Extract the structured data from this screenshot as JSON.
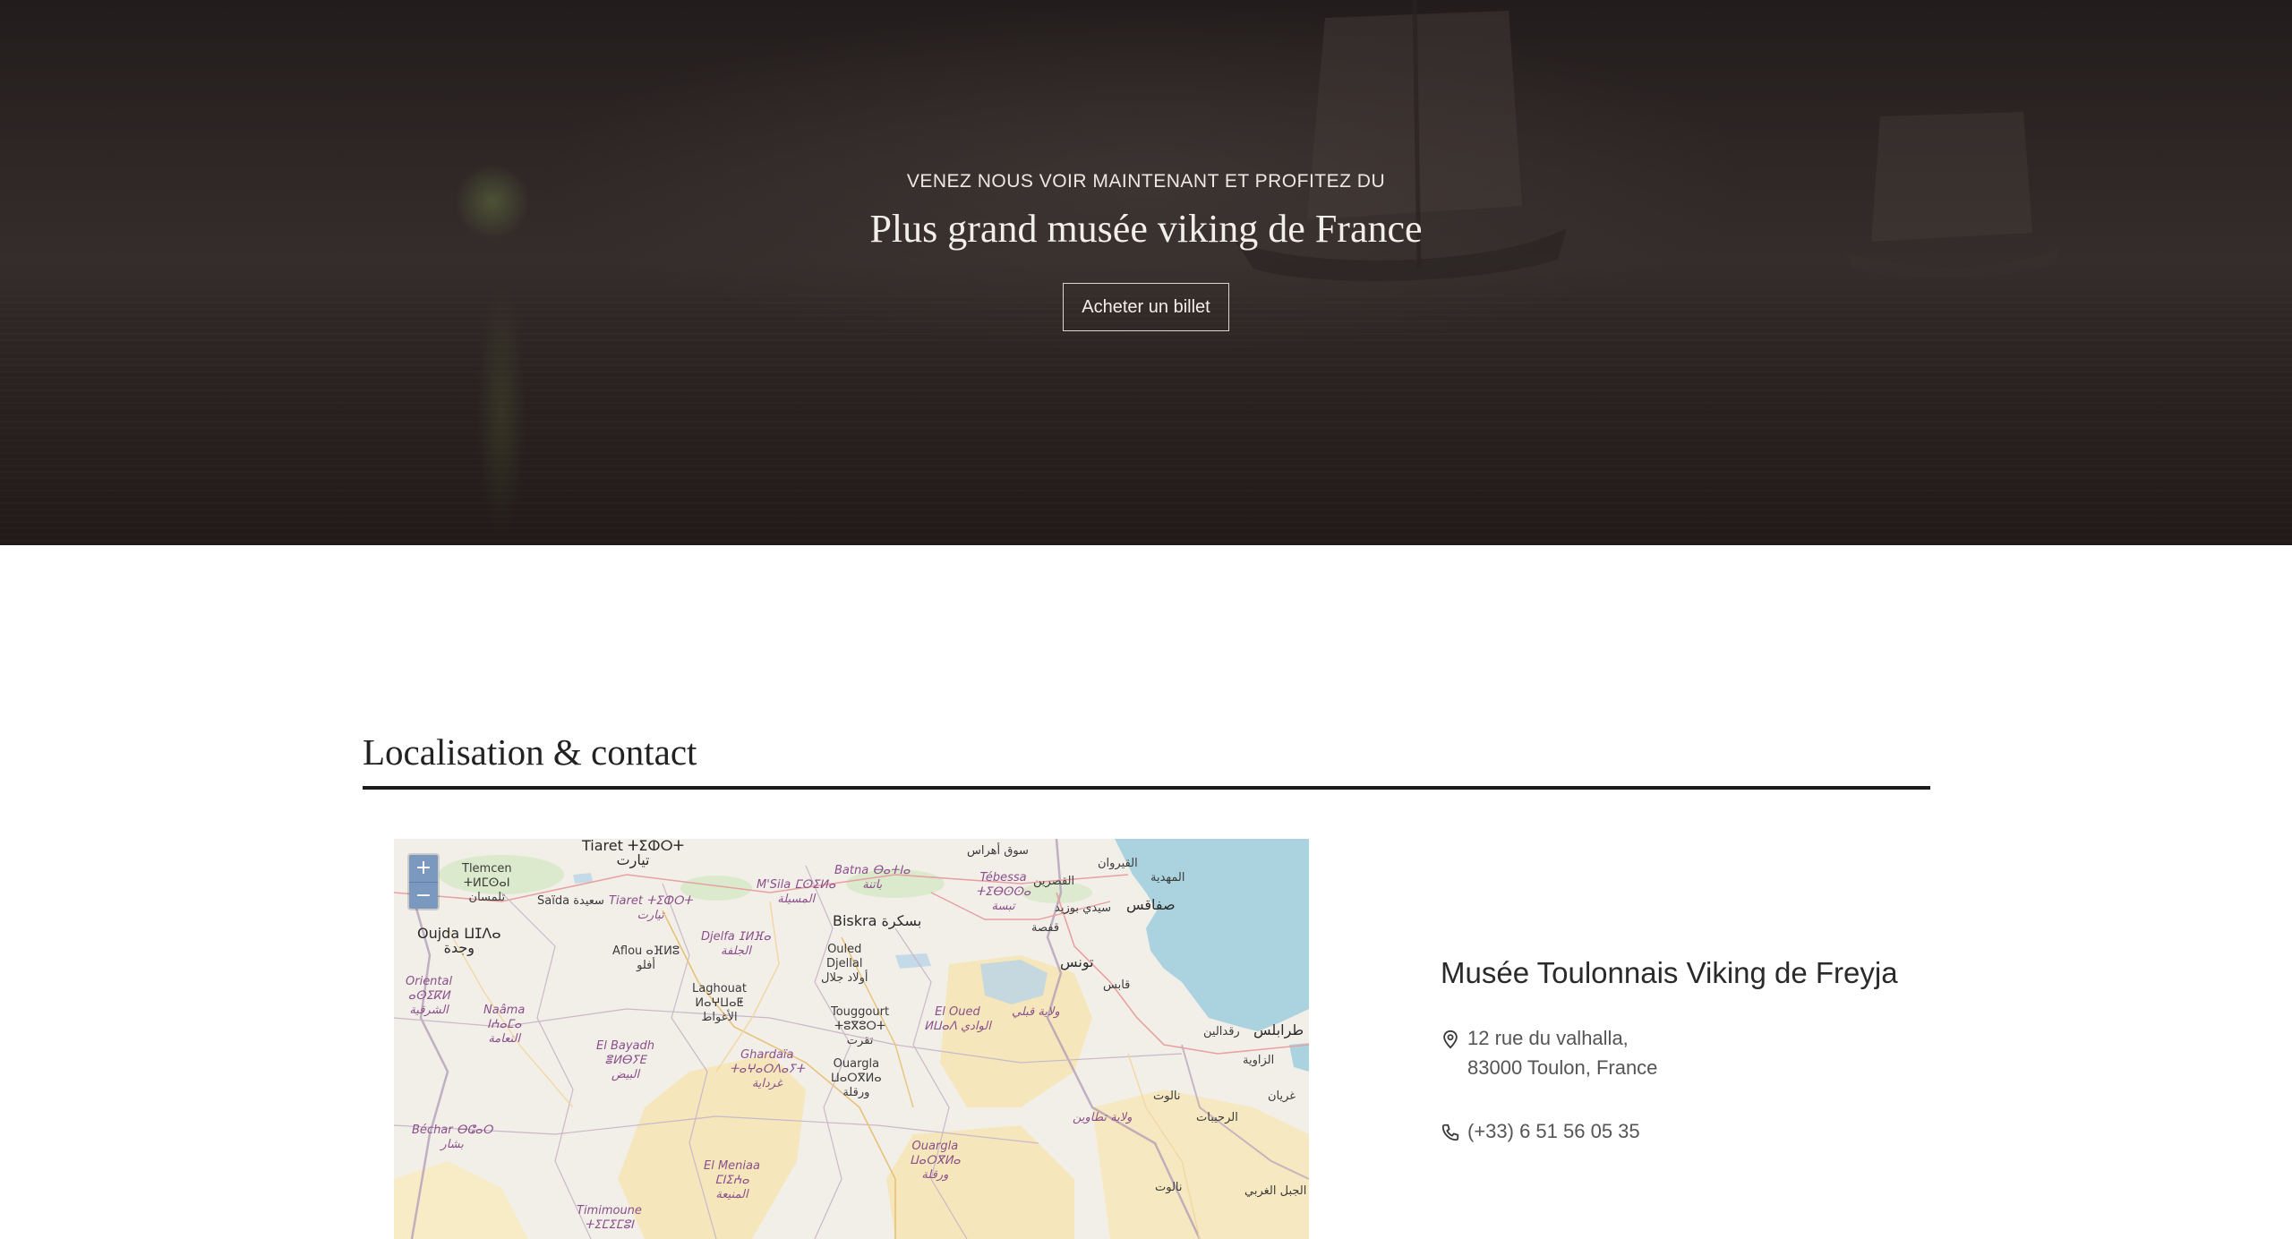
{
  "hero": {
    "kicker": "VENEZ NOUS VOIR MAINTENANT ET PROFITEZ DU",
    "title": "Plus grand musée viking de France",
    "cta_label": "Acheter un billet"
  },
  "location_section": {
    "title": "Localisation & contact"
  },
  "map": {
    "zoom_in": "+",
    "zoom_out": "−",
    "labels": {
      "tiaret": "Tiaret ⵜⵉⵀⵔⵜ\nتيارت",
      "tlemcen": "Tlemcen\nⵜⵍⵎⵙⴰⵏ\nتلمسان",
      "saida": "Saïda سعيدة",
      "tiaret2": "Tiaret ⵜⵉⵀⵔⵜ\nتيارت",
      "oujda": "Oujda ⵡⵊⴷⴰ\nوجدة",
      "aflou": "Aflou ⴰⴼⵍⵓ\nأفلو",
      "djelfa": "Djelfa ⵊⵍⴼⴰ\nالجلفة",
      "msila": "M'Sila ⵎⵙⵉⵍⴰ\nالمسيلة",
      "batna": "Batna ⴱⴰⵜⵏⴰ\nباتنة",
      "tebessa": "Tébessa\nⵜⵉⴱⵙⵙⴰ\nتبسة",
      "biskra": "Biskra بسكرة",
      "ouled_djellal": "Ouled\nDjellal\nأولاد جلال",
      "laghouat": "Laghouat\nⵍⴰⵖⵡⴰⵟ\nالأغواط",
      "oriental": "Oriental\nⴰⵙⵉⴽⵍ\nالشرقية",
      "naama": "Naâma\nⵏⵄⴰⵎⴰ\nالنعامة",
      "el_bayadh": "El Bayadh\nⴻⵍⴱⵢⴹ\nالبيض",
      "ghardaia": "Ghardaïa\nⵜⴰⵖⴰⵔⴷⴰⵢⵜ\nغرداية",
      "touggourt": "Touggourt\nⵜⵓⴳⵓⵔⵜ\nتقرت",
      "el_oued": "El Oued\nⵍⵡⴰⴷ الوادي",
      "ouargla": "Ouargla\nⵡⴰⵔⴳⵍⴰ\nورقلة",
      "ouargla2": "Ouargla\nⵡⴰⵔⴳⵍⴰ\nورقلة",
      "bechar": "Béchar ⴱⵛⴰⵔ\nبشار",
      "el_meniaa": "El Meniaa\nⵎⵏⵉⵄⴰ\nالمنيعة",
      "timimoune": "Timimoune\nⵜⵉⵎⵉⵎⵓⵏ",
      "tunis": "تونس",
      "sfax": "صفاقس",
      "kairouan": "القيروان",
      "gafsa": "قفصة",
      "gabes": "قابس",
      "mahdia": "المهدية",
      "souk_ahras": "سوق أهراس",
      "kasserine": "القصرين",
      "sidi_bouzid": "سيدي بوزيد",
      "tripoli": "طرابلس",
      "zawiya": "الزاوية",
      "nalut": "نالوت",
      "kebili": "ولاية قبلي",
      "tataouine": "ولاية تطاوين",
      "rajban": "الرحيبات",
      "jabal": "الجبل الغربي",
      "nalut2": "نالوت",
      "gharyan": "غريان",
      "rakdalin": "رقدالين"
    }
  },
  "contact": {
    "name": "Musée Toulonnais Viking de Freyja",
    "address_line1": "12 rue du valhalla,",
    "address_line2": "83000 Toulon, France",
    "phone": "(+33) 6 51 56 05 35"
  },
  "icons": {
    "address": "location-pin-icon",
    "phone": "phone-icon"
  }
}
